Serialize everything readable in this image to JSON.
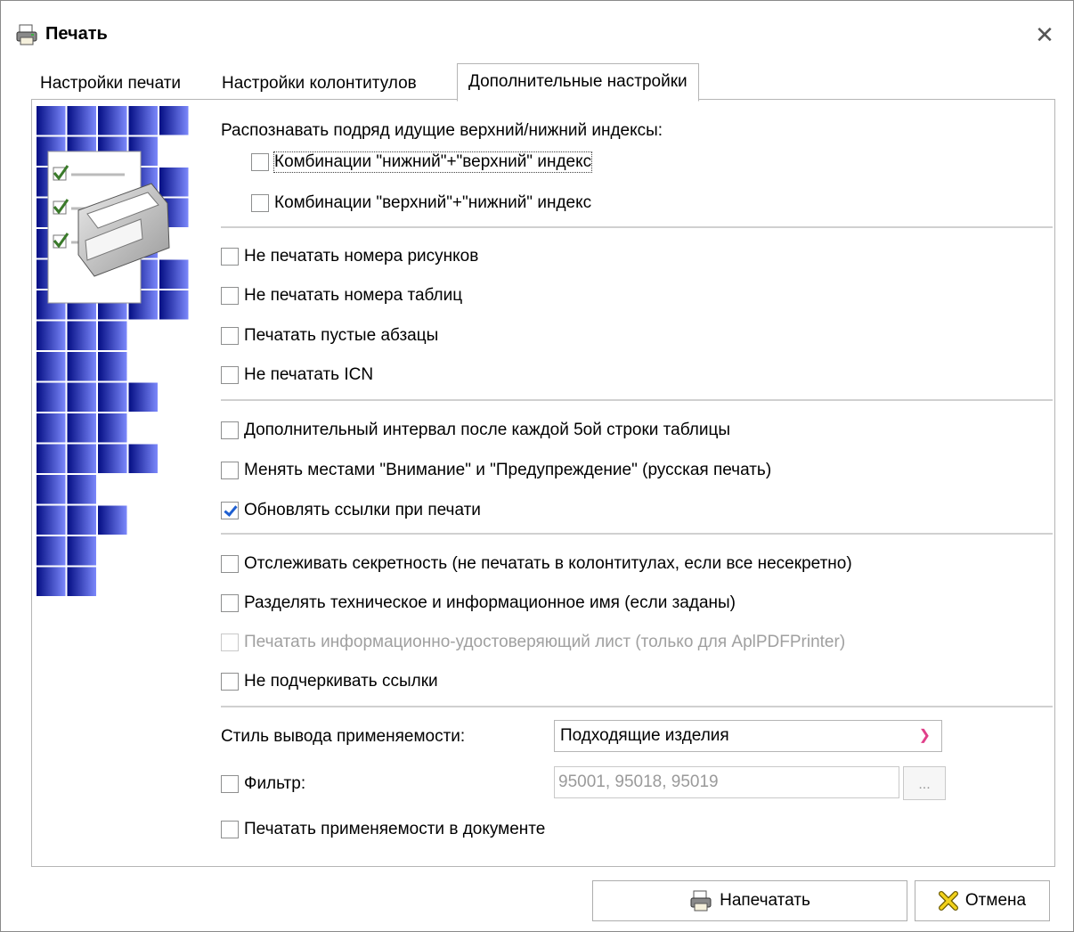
{
  "window": {
    "title": "Печать",
    "close_glyph": "✕"
  },
  "tabs": [
    {
      "label": "Настройки печати",
      "active": false
    },
    {
      "label": "Настройки колонтитулов",
      "active": false
    },
    {
      "label": "Дополнительные настройки",
      "active": true
    }
  ],
  "index_section": {
    "heading": "Распознавать подряд идущие верхний/нижний индексы:",
    "options": [
      {
        "label": "Комбинации \"нижний\"+\"верхний\" индекс",
        "checked": false
      },
      {
        "label": "Комбинации \"верхний\"+\"нижний\" индекс",
        "checked": false
      }
    ]
  },
  "group1": [
    {
      "label": "Не печатать номера рисунков",
      "checked": false
    },
    {
      "label": "Не печатать номера таблиц",
      "checked": false
    },
    {
      "label": "Печатать пустые абзацы",
      "checked": false
    },
    {
      "label": "Не печатать ICN",
      "checked": false
    }
  ],
  "group2": [
    {
      "label": "Дополнительный интервал после каждой 5ой строки таблицы",
      "checked": false
    },
    {
      "label": "Менять местами \"Внимание\" и \"Предупреждение\" (русская печать)",
      "checked": false
    },
    {
      "label": "Обновлять ссылки при печати",
      "checked": true
    }
  ],
  "group3": [
    {
      "label": "Отслеживать секретность (не печатать в колонтитулах, если все несекретно)",
      "checked": false,
      "disabled": false
    },
    {
      "label": "Разделять техническое и информационное имя (если заданы)",
      "checked": false,
      "disabled": false
    },
    {
      "label": "Печатать информационно-удостоверяющий лист (только для AplPDFPrinter)",
      "checked": false,
      "disabled": true
    },
    {
      "label": "Не подчеркивать ссылки",
      "checked": false,
      "disabled": false
    }
  ],
  "applicability": {
    "style_label": "Стиль вывода применяемости:",
    "style_value": "Подходящие изделия",
    "filter_label": "Фильтр:",
    "filter_checked": false,
    "filter_value": "95001, 95018, 95019",
    "dots_label": "...",
    "print_label": "Печатать применяемости в документе",
    "print_checked": false
  },
  "buttons": {
    "print": "Напечатать",
    "cancel": "Отмена"
  },
  "colors": {
    "accent_check": "#1e5fd1",
    "deco_dark": "#000a80",
    "deco_light": "#7f8cff",
    "chevron": "#e0408a"
  },
  "icons": {
    "title": "printer-icon",
    "decor": "printer-checklist-icon",
    "print": "printer-icon",
    "cancel": "cancel-x-icon"
  }
}
